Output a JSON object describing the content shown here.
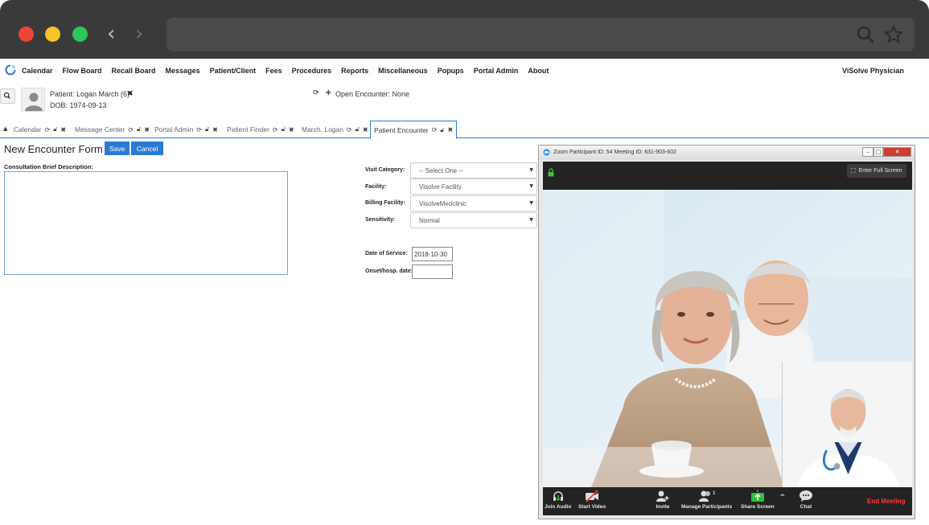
{
  "browser": {
    "nav_back": "‹",
    "nav_forward": "›"
  },
  "nav": {
    "items": [
      "Calendar",
      "Flow Board",
      "Recall Board",
      "Messages",
      "Patient/Client",
      "Fees",
      "Procedures",
      "Reports",
      "Miscellaneous",
      "Popups",
      "Portal Admin",
      "About"
    ],
    "brand": "ViSolve Physician"
  },
  "patient": {
    "name_label": "Patient: Logan March (6)",
    "dob_label": "DOB: 1974-09-13",
    "open_encounter": "Open Encounter: None"
  },
  "tabs": [
    {
      "label": "Calendar",
      "active": false
    },
    {
      "label": "Message Center",
      "active": false
    },
    {
      "label": "Portal Admin",
      "active": false
    },
    {
      "label": "Patient Finder",
      "active": false
    },
    {
      "label": "March, Logan",
      "active": false
    },
    {
      "label": "Patient Encounter",
      "active": true
    }
  ],
  "form": {
    "title": "New Encounter Form",
    "save_label": "Save",
    "cancel_label": "Cancel",
    "consultation_label": "Consultation Brief Description:",
    "visit_category_label": "Visit Category:",
    "visit_category_value": "-- Select One --",
    "facility_label": "Facility:",
    "facility_value": "Visolve Facility",
    "billing_facility_label": "Billing Facility:",
    "billing_facility_value": "VisolveMedclinic",
    "sensitivity_label": "Sensitivity:",
    "sensitivity_value": "Normal",
    "date_of_service_label": "Date of Service:",
    "date_of_service_value": "2018-10-30",
    "onset_label": "Onset/hosp. date:",
    "onset_value": ""
  },
  "zoom": {
    "title": "Zoom Participant ID: 54    Meeting ID: 631-903-602",
    "fullscreen_label": "Enter Full Screen",
    "participant_count": "1",
    "toolbar": {
      "join_audio": "Join Audio",
      "start_video": "Start Video",
      "invite": "Invite",
      "manage_participants": "Manage Participants",
      "share_screen": "Share Screen",
      "chat": "Chat",
      "end_meeting": "End Meeting"
    }
  },
  "colors": {
    "accent": "#2a7bd4",
    "chrome_bg": "#3a3a3a",
    "end_meeting": "#ff3b30",
    "share_green": "#2fbf3c"
  }
}
